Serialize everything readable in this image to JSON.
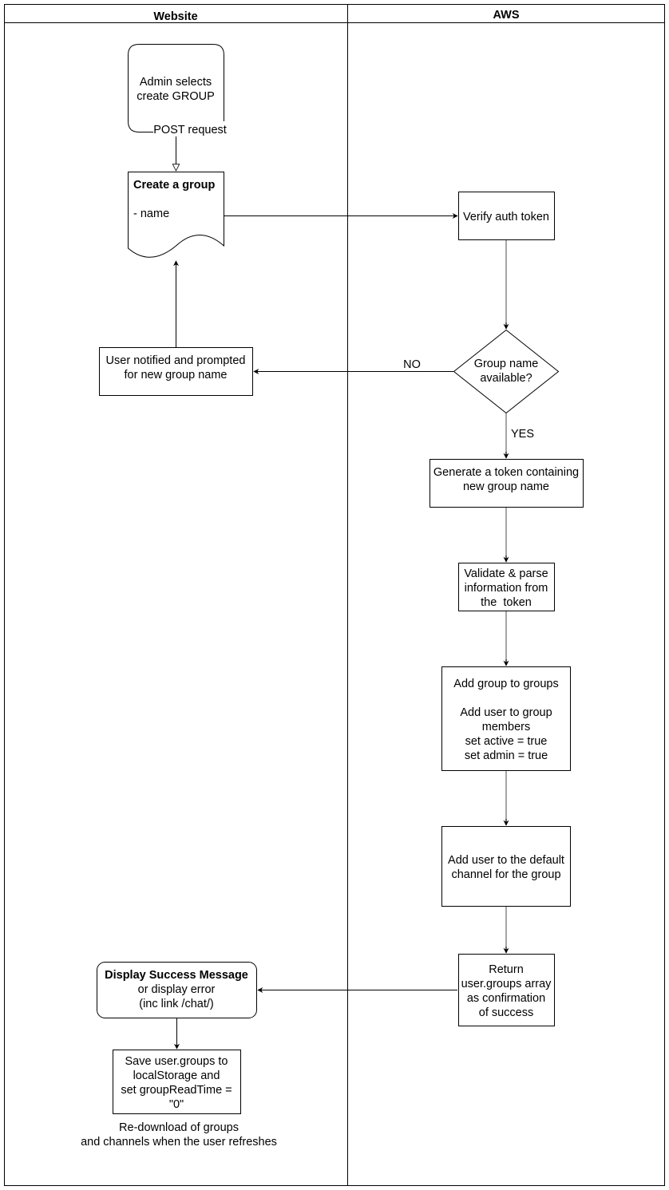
{
  "diagram": {
    "type": "swimlane-flowchart",
    "lanes": [
      {
        "id": "website",
        "title": "Website"
      },
      {
        "id": "aws",
        "title": "AWS"
      }
    ],
    "nodes": {
      "admin_start": {
        "lane": "website",
        "shape": "rounded-rect",
        "lines": [
          "Admin selects",
          "create GROUP"
        ]
      },
      "create_group": {
        "lane": "website",
        "shape": "document",
        "title": "Create a group",
        "lines": [
          "- name"
        ]
      },
      "user_notified": {
        "lane": "website",
        "shape": "rect",
        "lines": [
          "User notified and prompted",
          "for new group name"
        ]
      },
      "verify_token": {
        "lane": "aws",
        "shape": "rect",
        "lines": [
          "Verify auth token"
        ]
      },
      "name_available": {
        "lane": "aws",
        "shape": "diamond",
        "lines": [
          "Group name",
          "available?"
        ]
      },
      "generate_token": {
        "lane": "aws",
        "shape": "rect",
        "lines": [
          "Generate a token containing",
          "new group name"
        ]
      },
      "validate_parse": {
        "lane": "aws",
        "shape": "rect",
        "lines": [
          "Validate & parse",
          "information from",
          "the  token"
        ]
      },
      "add_group": {
        "lane": "aws",
        "shape": "rect",
        "lines": [
          "Add group to groups",
          "",
          "Add user to group",
          "members",
          "set active = true",
          "set admin = true"
        ]
      },
      "add_default_channel": {
        "lane": "aws",
        "shape": "rect",
        "lines": [
          "Add user to the default",
          "channel for the group"
        ]
      },
      "return_groups": {
        "lane": "aws",
        "shape": "rect",
        "lines": [
          "Return",
          "user.groups array",
          "as confirmation",
          "of success"
        ]
      },
      "display_success": {
        "lane": "website",
        "shape": "rounded-rect",
        "title": "Display Success Message",
        "lines": [
          "or display error",
          "(inc link /chat/)"
        ]
      },
      "save_groups": {
        "lane": "website",
        "shape": "rect",
        "lines": [
          "Save user.groups to",
          "localStorage and",
          "set groupReadTime =",
          "\"0\""
        ]
      }
    },
    "edges": [
      {
        "from": "admin_start",
        "to": "create_group",
        "label": "POST request"
      },
      {
        "from": "create_group",
        "to": "verify_token",
        "label": ""
      },
      {
        "from": "verify_token",
        "to": "name_available",
        "label": ""
      },
      {
        "from": "name_available",
        "to": "user_notified",
        "label": "NO"
      },
      {
        "from": "name_available",
        "to": "generate_token",
        "label": "YES"
      },
      {
        "from": "user_notified",
        "to": "create_group",
        "label": ""
      },
      {
        "from": "generate_token",
        "to": "validate_parse",
        "label": ""
      },
      {
        "from": "validate_parse",
        "to": "add_group",
        "label": ""
      },
      {
        "from": "add_group",
        "to": "add_default_channel",
        "label": ""
      },
      {
        "from": "add_default_channel",
        "to": "return_groups",
        "label": ""
      },
      {
        "from": "return_groups",
        "to": "display_success",
        "label": ""
      },
      {
        "from": "display_success",
        "to": "save_groups",
        "label": ""
      }
    ],
    "annotations": {
      "footer_note": [
        "Re-download of groups",
        "and channels when the user refreshes"
      ]
    }
  }
}
